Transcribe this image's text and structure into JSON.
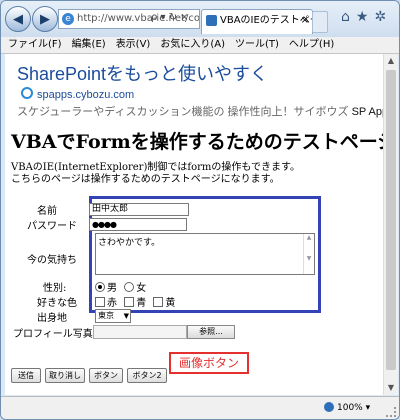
{
  "browser": {
    "address": "http://www.vba-ie.net/code",
    "address_buttons": "ρ ▾ ↻ ×",
    "tab_title": "VBAのIEのテストペー…",
    "tab_close": "×",
    "toolbar_icons": "⌂★✲",
    "zoom": "100%"
  },
  "menu": [
    "ファイル(F)",
    "編集(E)",
    "表示(V)",
    "お気に入り(A)",
    "ツール(T)",
    "ヘルプ(H)"
  ],
  "ad": {
    "title": "SharePointをもっと使いやすく",
    "url": "spapps.cybozu.com",
    "desc": "スケジューラーやディスカッション機能の 操作性向上！サイボウズ ",
    "desc_bold": "SP Apps"
  },
  "page": {
    "heading": "VBAでFormを操作するためのテストページ",
    "intro_line1": "VBAのIE(InternetExplorer)制御ではformの操作もできます。",
    "intro_line2": "こちらのページは操作するためのテストページになります。"
  },
  "form": {
    "name_label": "名前",
    "name_value": "田中太郎",
    "password_label": "パスワード",
    "password_value": "●●●●",
    "mood_label": "今の気持ち",
    "mood_value": "さわやかです。",
    "gender_label": "性別:",
    "gender_options": [
      "男",
      "女"
    ],
    "gender_selected": "男",
    "color_label": "好きな色",
    "color_options": [
      "赤",
      "青",
      "黄"
    ],
    "origin_label": "出身地",
    "origin_value": "東京",
    "photo_label": "プロフィール写真",
    "browse_label": "参照...",
    "image_button": "画像ボタン",
    "buttons": [
      "送信",
      "取り消し",
      "ボタン",
      "ボタン2"
    ]
  }
}
